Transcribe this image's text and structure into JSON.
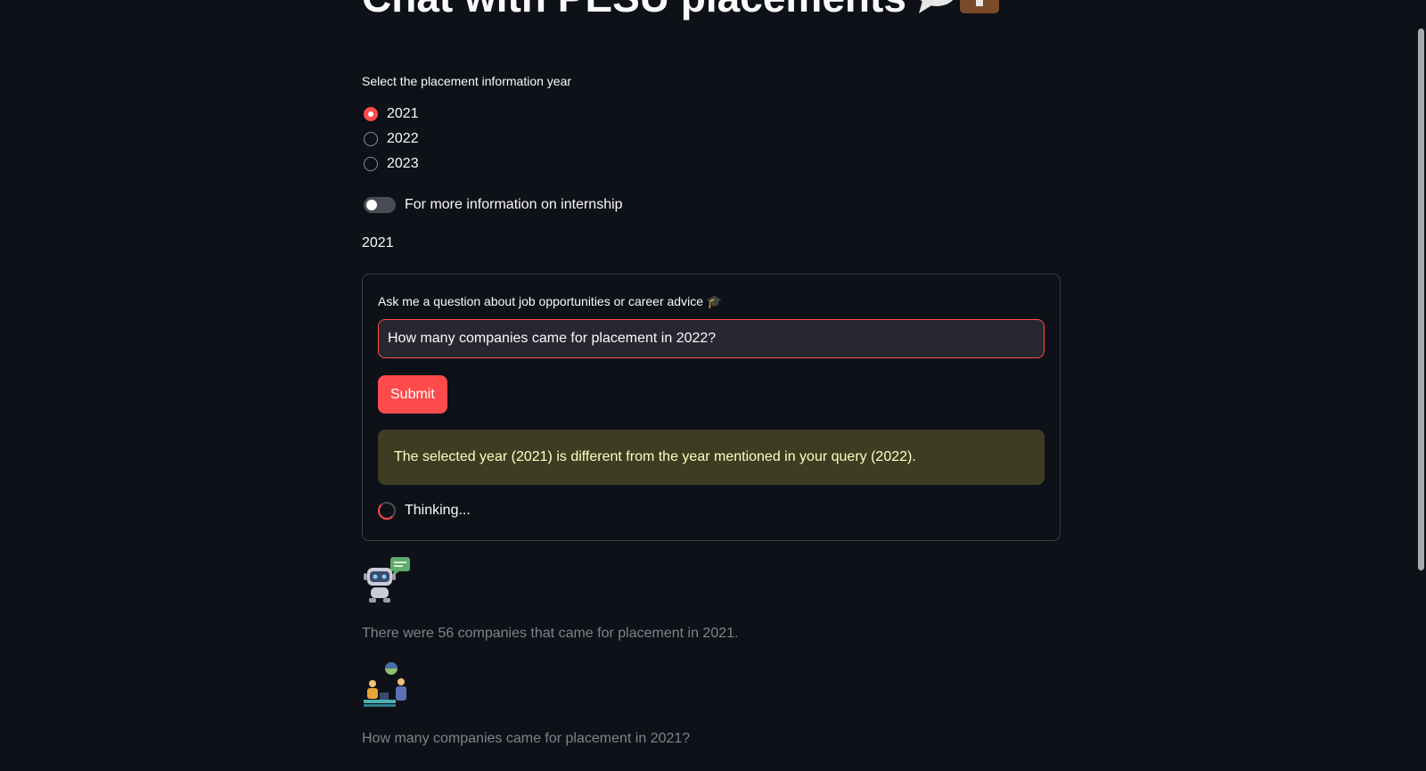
{
  "header": {
    "title": "Chat with PESU placements"
  },
  "year_selector": {
    "label": "Select the placement information year",
    "options": [
      "2021",
      "2022",
      "2023"
    ],
    "selected": "2021"
  },
  "toggle": {
    "label": "For more information on internship",
    "on": false
  },
  "selected_year_display": "2021",
  "form": {
    "label": "Ask me a question about job opportunities or career advice 🎓",
    "input_value": "How many companies came for placement in 2022?",
    "submit_label": "Submit",
    "warning": "The selected year (2021) is different from the year mentioned in your query (2022).",
    "status": "Thinking..."
  },
  "chat": {
    "messages": [
      {
        "role": "bot",
        "icon": "robot-avatar-icon",
        "text": "There were 56 companies that came for placement in 2021."
      },
      {
        "role": "user",
        "icon": "user-avatar-icon",
        "text": "How many companies came for placement in 2021?"
      }
    ]
  },
  "colors": {
    "background": "#0e1117",
    "accent": "#ff4b4b",
    "warning_bg": "#3e3d23",
    "warning_text": "#ffffc2",
    "muted_text": "#808389"
  }
}
